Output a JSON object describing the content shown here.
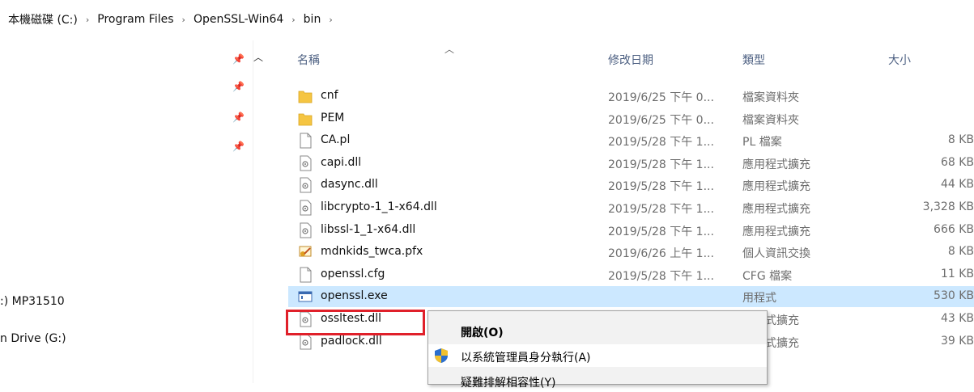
{
  "breadcrumb": {
    "items": [
      "本機磁碟 (C:)",
      "Program Files",
      "OpenSSL-Win64",
      "bin"
    ]
  },
  "nav": {
    "items": [
      ":) MP31510",
      "n Drive (G:)"
    ]
  },
  "columns": {
    "name": "名稱",
    "date": "修改日期",
    "type": "類型",
    "size": "大小"
  },
  "files": [
    {
      "name": "cnf",
      "date": "2019/6/25 下午 0...",
      "type": "檔案資料夾",
      "size": "",
      "icon": "folder-icon"
    },
    {
      "name": "PEM",
      "date": "2019/6/25 下午 0...",
      "type": "檔案資料夾",
      "size": "",
      "icon": "folder-icon"
    },
    {
      "name": "CA.pl",
      "date": "2019/5/28 下午 1...",
      "type": "PL 檔案",
      "size": "8 KB",
      "icon": "file-icon"
    },
    {
      "name": "capi.dll",
      "date": "2019/5/28 下午 1...",
      "type": "應用程式擴充",
      "size": "68 KB",
      "icon": "dll-icon"
    },
    {
      "name": "dasync.dll",
      "date": "2019/5/28 下午 1...",
      "type": "應用程式擴充",
      "size": "44 KB",
      "icon": "dll-icon"
    },
    {
      "name": "libcrypto-1_1-x64.dll",
      "date": "2019/5/28 下午 1...",
      "type": "應用程式擴充",
      "size": "3,328 KB",
      "icon": "dll-icon"
    },
    {
      "name": "libssl-1_1-x64.dll",
      "date": "2019/5/28 下午 1...",
      "type": "應用程式擴充",
      "size": "666 KB",
      "icon": "dll-icon"
    },
    {
      "name": "mdnkids_twca.pfx",
      "date": "2019/6/26 上午 1...",
      "type": "個人資訊交換",
      "size": "8 KB",
      "icon": "certificate-icon"
    },
    {
      "name": "openssl.cfg",
      "date": "2019/5/28 下午 1...",
      "type": "CFG 檔案",
      "size": "11 KB",
      "icon": "file-icon"
    },
    {
      "name": "openssl.exe",
      "date": "",
      "type": "用程式",
      "size": "530 KB",
      "icon": "exe-icon"
    },
    {
      "name": "ossltest.dll",
      "date": "",
      "type": "用程式擴充",
      "size": "43 KB",
      "icon": "dll-icon"
    },
    {
      "name": "padlock.dll",
      "date": "",
      "type": "用程式擴充",
      "size": "39 KB",
      "icon": "dll-icon"
    }
  ],
  "context_menu": {
    "open": "開啟(O)",
    "run_as_admin": "以系統管理員身分執行(A)",
    "troubleshoot": "疑難排解相容性(Y)"
  },
  "colors": {
    "selection": "#cce8ff",
    "highlight_box": "#e0202a",
    "folder": "#f5c542"
  }
}
